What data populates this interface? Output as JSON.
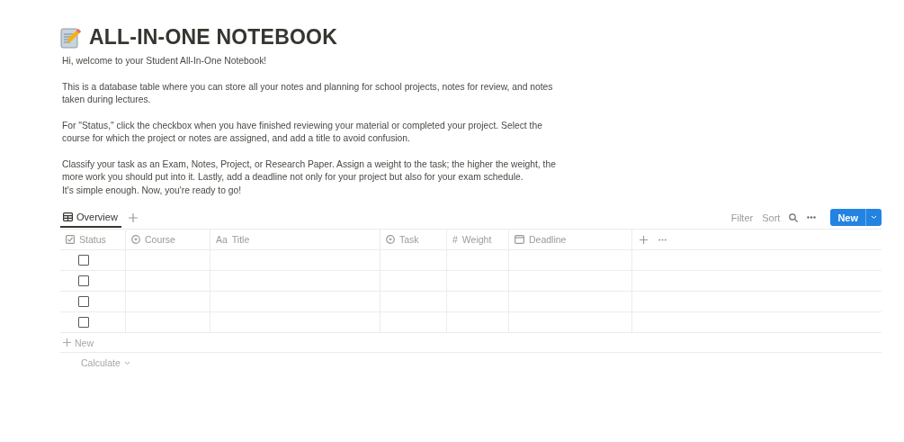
{
  "page": {
    "title": "ALL-IN-ONE NOTEBOOK"
  },
  "intro": [
    [
      "Hi, welcome to your Student All-In-One Notebook!"
    ],
    [
      "This is a database table where you can store all your notes and planning for school projects, notes for review, and notes taken during lectures."
    ],
    [
      "For \"Status,\" click the checkbox when you have finished reviewing your material or completed your project. Select the course for which the project or notes are assigned, and add a title to avoid confusion."
    ],
    [
      "Classify your task as an Exam, Notes, Project, or Research Paper. Assign a weight to the task; the higher the weight, the more work you should put into it. Lastly, add a deadline not only for your project but also for your exam schedule.",
      "It's simple enough. Now, you're ready to go!"
    ]
  ],
  "views": [
    {
      "label": "Overview",
      "selected": true
    }
  ],
  "toolbar": {
    "filter": "Filter",
    "sort": "Sort",
    "new_button": "New"
  },
  "table": {
    "columns": [
      {
        "kind": "checkbox",
        "label": "Status"
      },
      {
        "kind": "select",
        "label": "Course"
      },
      {
        "kind": "title",
        "glyph": "Aa",
        "label": "Title"
      },
      {
        "kind": "select",
        "label": "Task"
      },
      {
        "kind": "number",
        "glyph": "#",
        "label": "Weight"
      },
      {
        "kind": "date",
        "label": "Deadline"
      }
    ],
    "rows": [
      {
        "checked": false
      },
      {
        "checked": false
      },
      {
        "checked": false
      },
      {
        "checked": false
      }
    ],
    "add_row": "New",
    "calculate": "Calculate"
  }
}
